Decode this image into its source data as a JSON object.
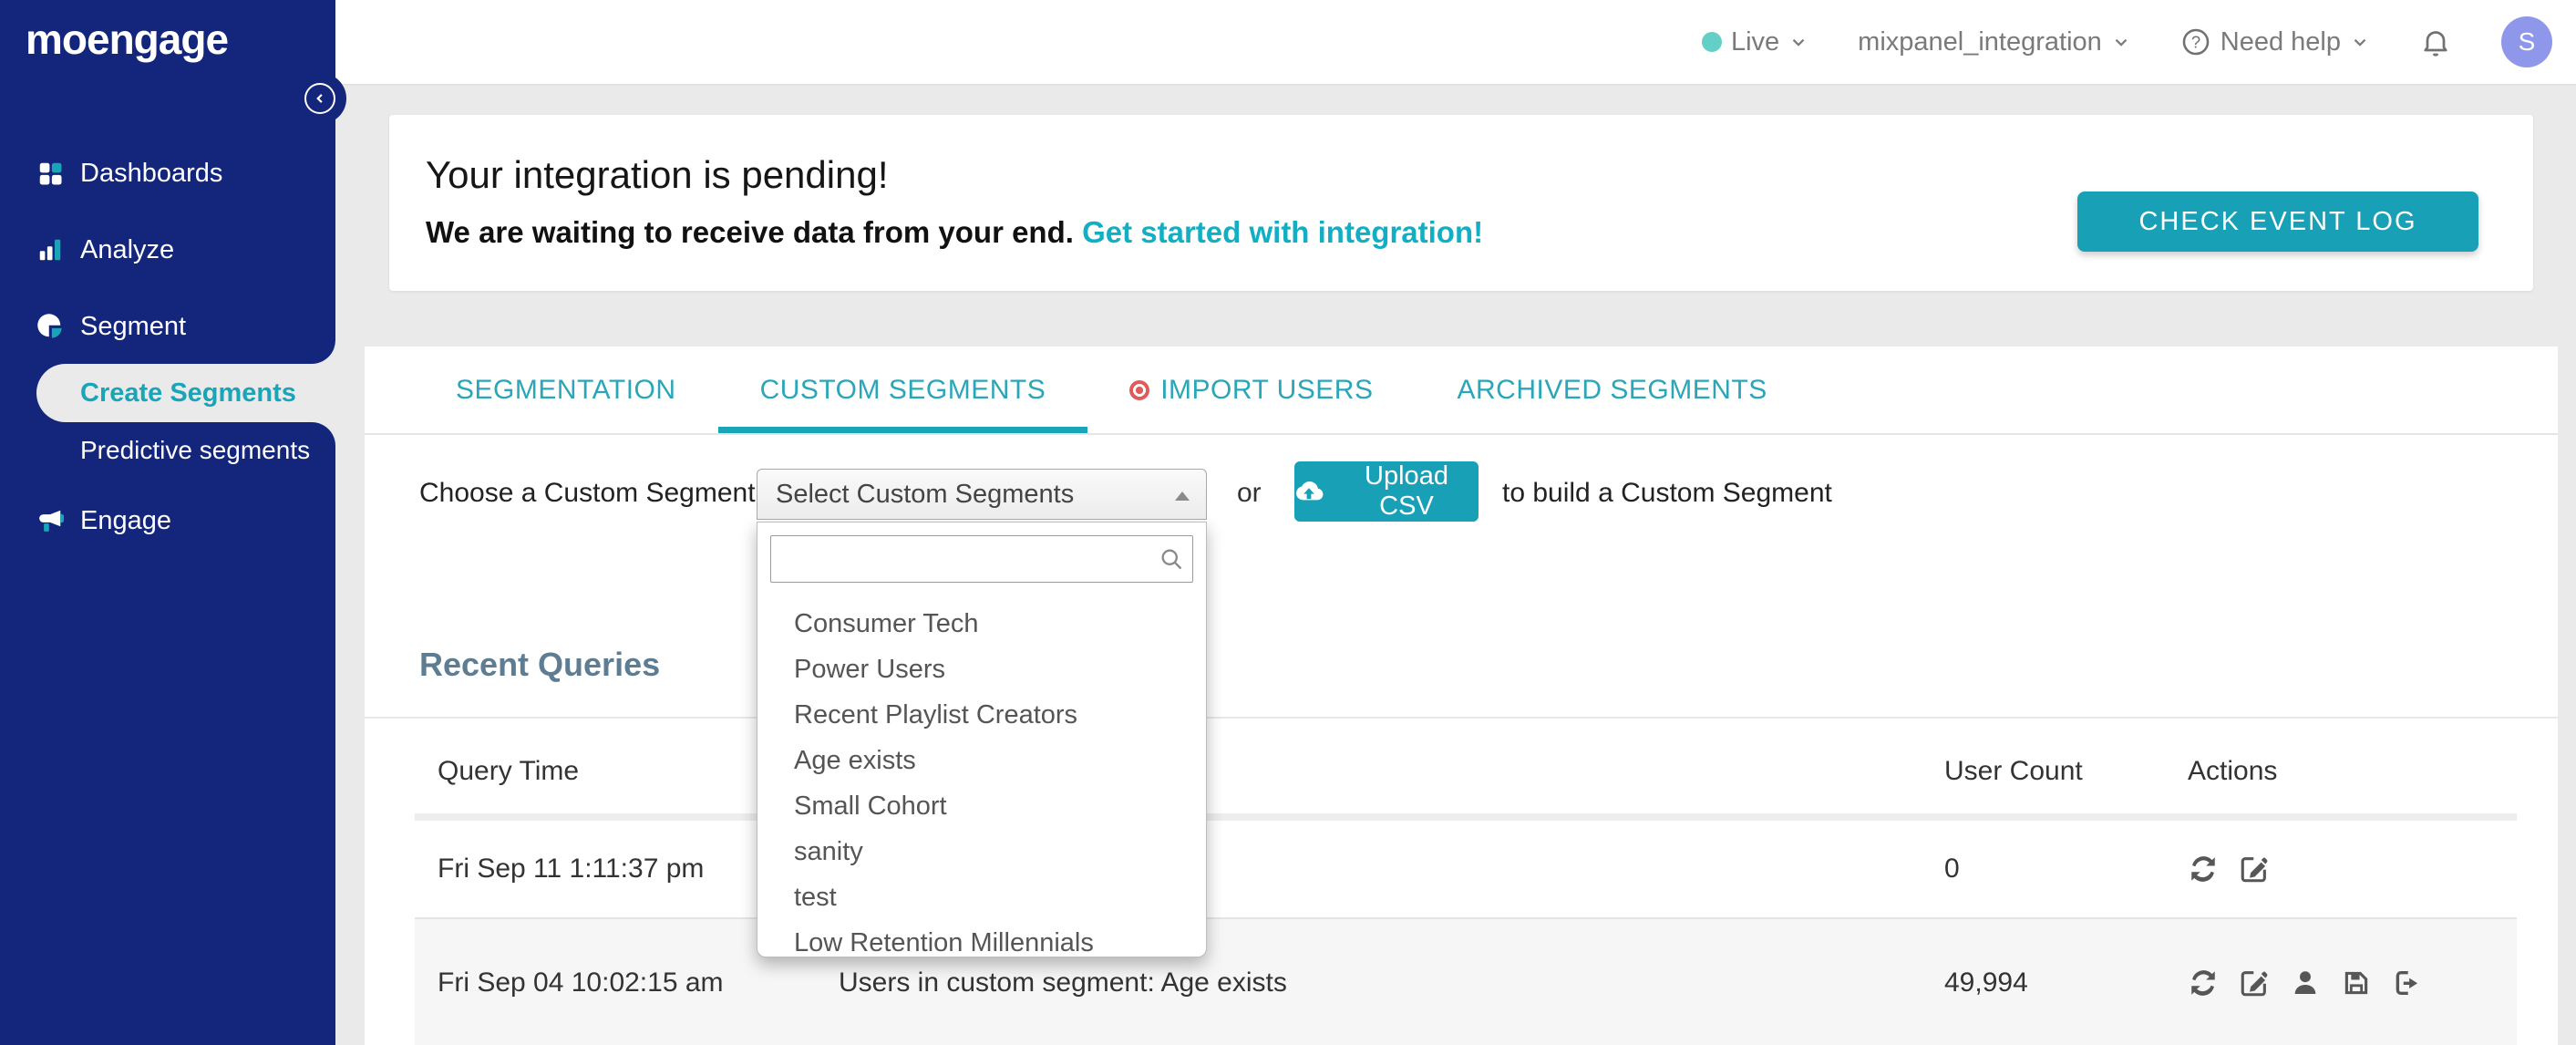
{
  "colors": {
    "sidebar_navy": "#13267B",
    "accent_teal": "#1AA4B8",
    "button_teal": "#17A0B6",
    "link_teal": "#12AFC4",
    "tab_teal": "#2AA6B9",
    "heading_slate": "#5E7D93",
    "import_dot_red": "#E25B5B",
    "live_dot_teal": "#63CFC7",
    "avatar_purple": "#8F97EA"
  },
  "sidebar": {
    "logo": "moengage",
    "nav": [
      {
        "label": "Dashboards",
        "icon": "dashboards-grid-icon"
      },
      {
        "label": "Analyze",
        "icon": "bar-chart-icon"
      },
      {
        "label": "Segment",
        "icon": "pie-chart-icon"
      },
      {
        "label": "Engage",
        "icon": "megaphone-icon"
      }
    ],
    "segment_submenu": [
      {
        "label": "Create Segments",
        "active": true
      },
      {
        "label": "Predictive segments",
        "active": false
      }
    ]
  },
  "header": {
    "env_label": "Live",
    "workspace": "mixpanel_integration",
    "help_label": "Need help",
    "avatar_initial": "S"
  },
  "banner": {
    "title": "Your integration is pending!",
    "message": "We are waiting to receive data from your end. ",
    "link": "Get started with integration!",
    "button": "CHECK EVENT LOG"
  },
  "tabs": {
    "items": [
      {
        "label": "SEGMENTATION",
        "active": false
      },
      {
        "label": "CUSTOM SEGMENTS",
        "active": true
      },
      {
        "label": "IMPORT USERS",
        "active": false,
        "dot_icon": "red-status-dot-icon"
      },
      {
        "label": "ARCHIVED SEGMENTS",
        "active": false
      }
    ]
  },
  "segment_picker": {
    "label": "Choose a Custom Segment:",
    "select_value": "Select Custom Segments",
    "or_text": "or",
    "upload_button": "Upload CSV",
    "suffix_text": "to build a Custom Segment",
    "search_value": "",
    "options": [
      "Consumer Tech",
      "Power Users",
      "Recent Playlist Creators",
      "Age exists",
      "Small Cohort",
      "sanity",
      "test",
      "Low Retention Millennials"
    ]
  },
  "recent_queries": {
    "title": "Recent Queries",
    "columns": [
      "Query Time",
      "",
      "User Count",
      "Actions"
    ],
    "rows": [
      {
        "time": "Fri Sep 11 1:11:37 pm",
        "query": "",
        "count": "0",
        "actions": [
          "refresh-icon",
          "edit-icon"
        ]
      },
      {
        "time": "Fri Sep 04 10:02:15 am",
        "query": "Users in custom segment: Age exists",
        "count": "49,994",
        "actions": [
          "refresh-icon",
          "edit-icon",
          "user-icon",
          "save-icon",
          "export-icon"
        ]
      }
    ]
  }
}
